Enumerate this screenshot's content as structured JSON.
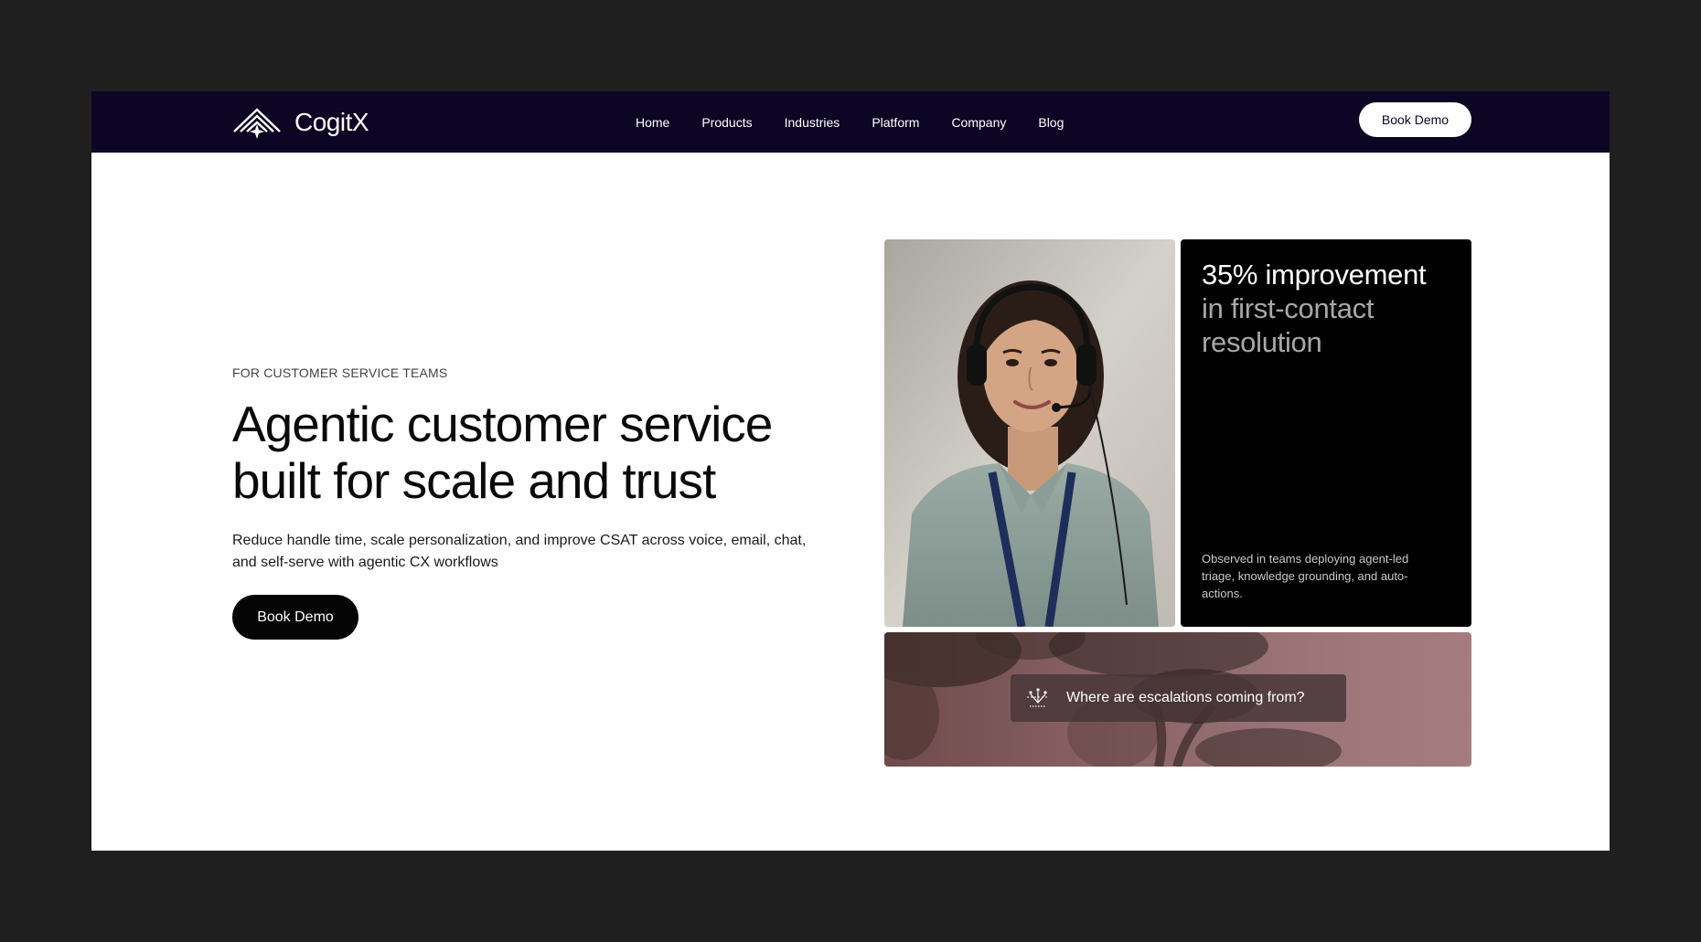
{
  "brand": {
    "name": "CogitX",
    "logo_icon": "mountain-star-logo"
  },
  "nav": {
    "items": [
      {
        "label": "Home"
      },
      {
        "label": "Products"
      },
      {
        "label": "Industries"
      },
      {
        "label": "Platform"
      },
      {
        "label": "Company"
      },
      {
        "label": "Blog"
      }
    ],
    "cta_label": "Book Demo"
  },
  "hero": {
    "eyebrow": "FOR CUSTOMER SERVICE TEAMS",
    "headline_line1": "Agentic customer service",
    "headline_line2": "built for scale and trust",
    "subtext": "Reduce handle time, scale personalization, and improve CSAT across voice, email, chat, and self-serve with agentic CX workflows",
    "cta_label": "Book Demo"
  },
  "stat_card": {
    "title_highlight": "35% improvement",
    "title_rest_line1": "in first-contact",
    "title_rest_line2": "resolution",
    "note": "Observed in teams deploying agent-led triage, knowledge grounding, and auto-actions."
  },
  "query_card": {
    "icon": "node-graph-icon",
    "question": "Where are escalations coming from?"
  },
  "colors": {
    "nav_background": "#0d0524",
    "stat_card_background": "#000000",
    "primary_button": "#050505"
  }
}
